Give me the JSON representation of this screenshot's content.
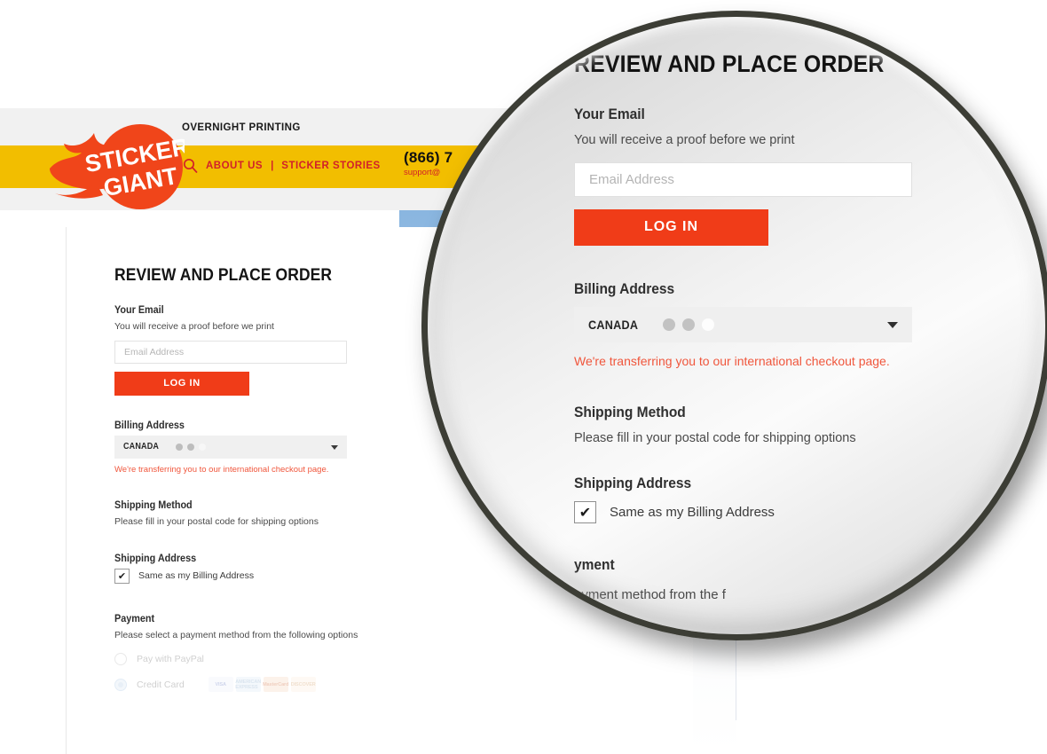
{
  "site": {
    "tagline": "OVERNIGHT PRINTING",
    "logo_line1": "STICKER",
    "logo_line2": "GIANT",
    "nav": [
      {
        "label": "ABOUT US"
      },
      {
        "label": "STICKER STORIES"
      }
    ],
    "nav_separator": "|",
    "phone": "(866) 7",
    "support_email": "support@"
  },
  "checkout": {
    "title": "REVIEW AND PLACE ORDER",
    "email": {
      "heading": "Your Email",
      "help": "You will receive a proof before we print",
      "placeholder": "Email Address",
      "value": "",
      "login_button": "LOG IN"
    },
    "billing": {
      "heading": "Billing Address",
      "country_selected": "CANADA",
      "loading_dots": 3,
      "error": "We're transferring you to our international checkout page."
    },
    "shipping_method": {
      "heading": "Shipping Method",
      "help": "Please fill in your postal code for shipping options"
    },
    "shipping_address": {
      "heading": "Shipping Address",
      "same_as_billing_label": "Same as my Billing Address",
      "same_as_billing_checked": true,
      "check_glyph": "✔"
    },
    "payment": {
      "heading": "Payment",
      "help": "Please select a payment method from the following options",
      "options": [
        {
          "label": "Pay with PayPal",
          "selected": false
        },
        {
          "label": "Credit Card",
          "selected": true
        }
      ],
      "card_logos": [
        "VISA",
        "AMERICAN EXPRESS",
        "MasterCard",
        "DISCOVER"
      ]
    }
  },
  "magnifier": {
    "title": "REVIEW AND PLACE ORDER",
    "email_heading": "Your Email",
    "email_help": "You will receive a proof before we print",
    "email_placeholder": "Email Address",
    "login_button": "LOG IN",
    "billing_heading": "Billing Address",
    "country_selected": "CANADA",
    "billing_error": "We're transferring you to our international checkout page.",
    "shipping_method_heading": "Shipping Method",
    "shipping_method_help": "Please fill in your postal code for shipping options",
    "shipping_address_heading": "Shipping Address",
    "same_as_billing_label": "Same as my Billing Address",
    "check_glyph": "✔",
    "payment_heading_clipped": "yment",
    "payment_help_clipped": "ayment method from the f"
  },
  "colors": {
    "brand_orange": "#f03c18",
    "brand_yellow": "#f2be00",
    "nav_red": "#d2202a",
    "error_red": "#f0563c",
    "blue_panel": "#8ab6e0",
    "ring_dark": "#3c3d35"
  }
}
